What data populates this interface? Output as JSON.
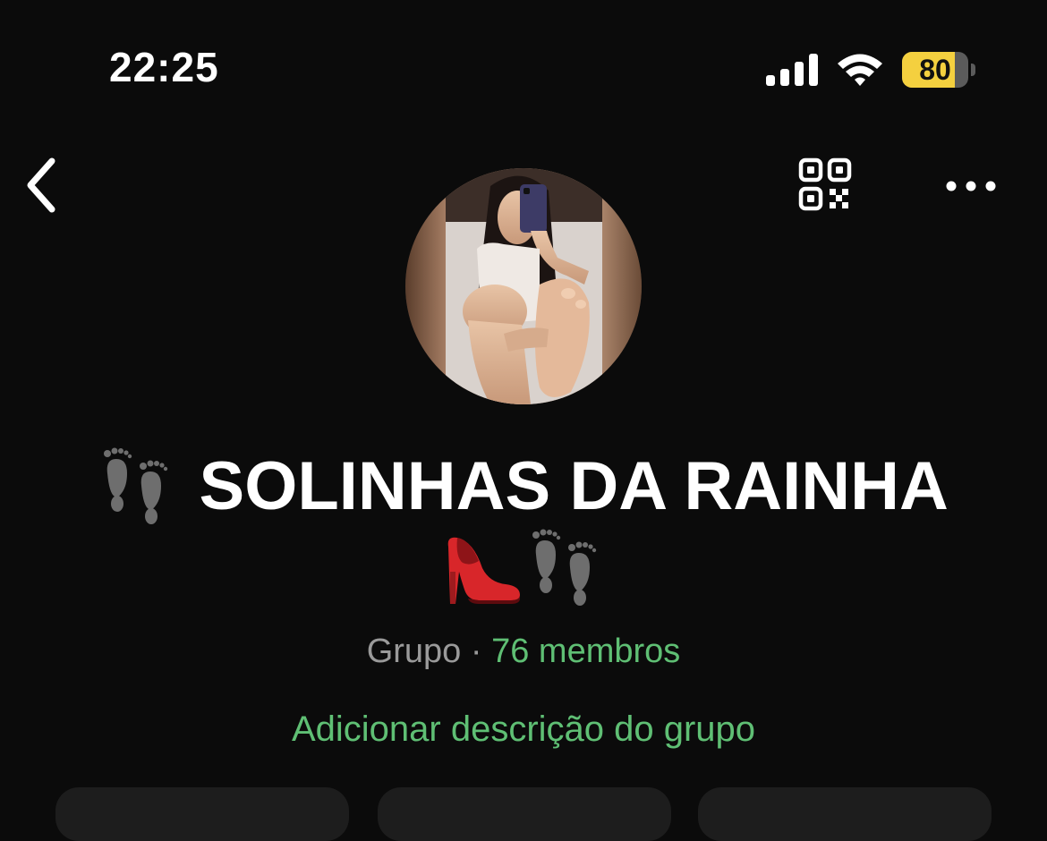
{
  "status_bar": {
    "time": "22:25",
    "battery_level": "80",
    "battery_fraction": 0.8,
    "signal_icon": "cellular-signal-icon",
    "wifi_icon": "wifi-icon"
  },
  "nav": {
    "back_icon": "chevron-left-icon",
    "qr_icon": "qr-code-icon",
    "more_icon": "more-horizontal-icon"
  },
  "group": {
    "avatar_icon": "group-avatar-photo",
    "title_prefix_emoji": "footprints-icon",
    "title": "SOLINHAS DA RAINHA",
    "title_suffix_emojis": [
      "high-heel-icon",
      "footprints-icon"
    ],
    "type": "Grupo",
    "separator": "·",
    "members": "76 membros",
    "add_description": "Adicionar descrição do grupo"
  },
  "colors": {
    "background": "#0b0b0b",
    "accent_green": "#5fbf74",
    "muted_text": "#9a9a9a",
    "battery_yellow": "#f4d03f"
  }
}
